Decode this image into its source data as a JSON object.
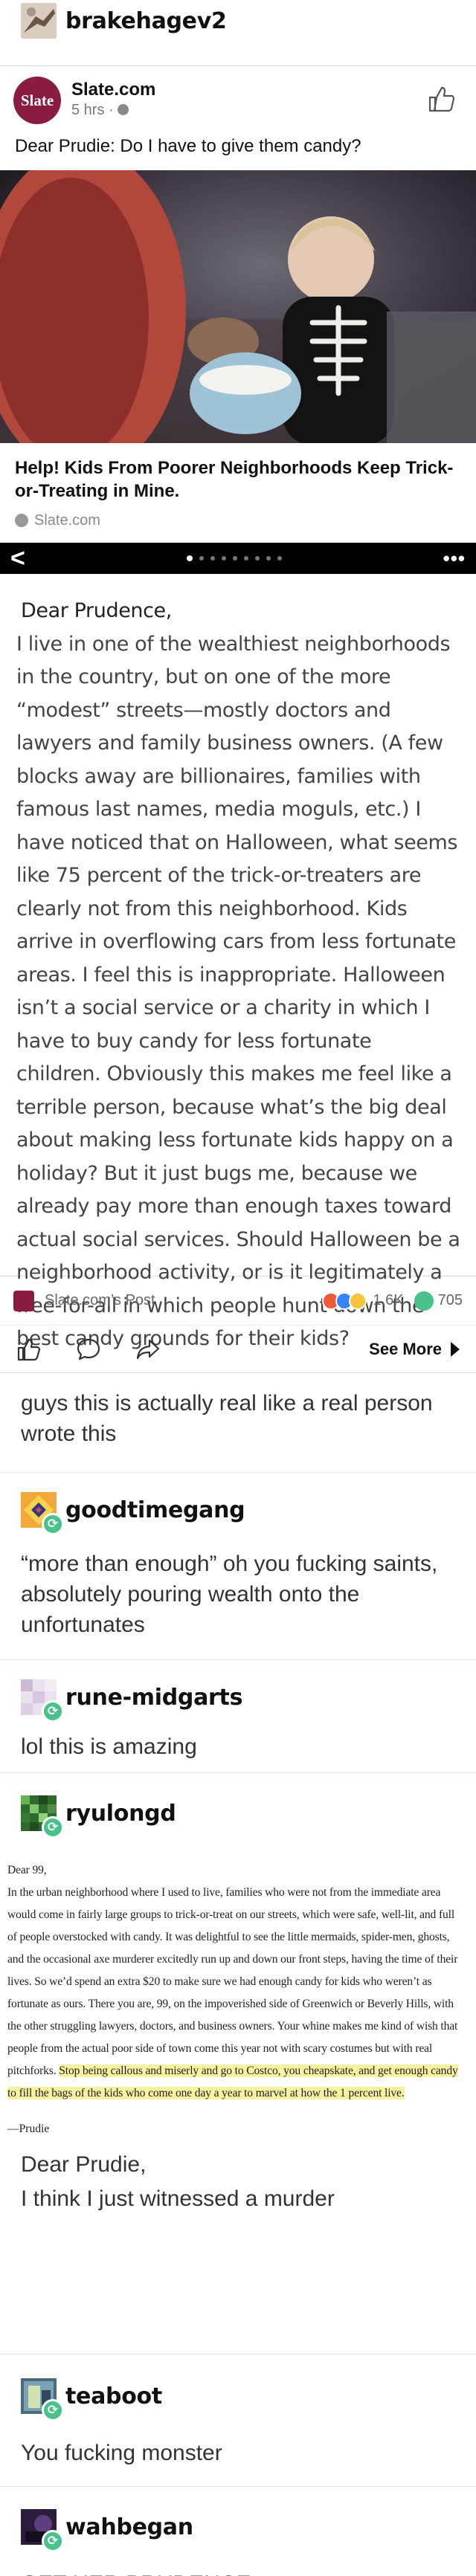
{
  "post": {
    "original_user": "brakehagev2",
    "fb_embed": {
      "source_name": "Slate.com",
      "logo_text": "Slate",
      "time": "5 hrs · ",
      "caption": "Dear Prudie: Do I have to give them candy?",
      "link_title": "Help! Kids From Poorer Neighborhoods Keep Trick-or-Treating in Mine.",
      "link_domain": "Slate.com",
      "carousel_back": "<",
      "carousel_more": "•••",
      "letter_greeting": "Dear Prudence,",
      "letter_body": "I live in one of the wealthiest neighborhoods in the country, but on one of the more “modest” streets—mostly doctors and lawyers and family business owners. (A few blocks away are billionaires, families with famous last names, media moguls, etc.) I have noticed that on Halloween, what seems like 75 percent of the trick-or-treaters are clearly not from this neighborhood. Kids arrive in overflowing cars from less fortunate areas. I feel this is inappropriate. Halloween isn’t a social service or a charity in which I have to buy candy for less fortunate children. Obviously this makes me feel like a terrible person, because what’s the big deal about making less fortunate kids happy on a holiday? But it just bugs me, because we already pay more than enough taxes toward actual social services. Should Halloween be a neighborhood activity, or is it legitimately a free-for-all in which people hunt down the best candy grounds for their kids?",
      "post_of": "Slate.com’s Post",
      "reaction_count": "1.6K",
      "comment_count": "705",
      "see_more": "See More"
    }
  },
  "replies": [
    {
      "user": "",
      "text": "guys this is actually real like a real person wrote this"
    },
    {
      "user": "goodtimegang",
      "text": "“more than enough” oh you fucking saints, absolutely pouring wealth onto the unfortunates"
    },
    {
      "user": "rune-midgarts",
      "text": "lol this is amazing"
    },
    {
      "user": "ryulongd",
      "text": "Dear Prudie,\nI think I just witnessed a murder"
    },
    {
      "user": "teaboot",
      "text": "You fucking monster"
    },
    {
      "user": "wahbegan",
      "text": "GET HER PRUDENCE"
    }
  ],
  "prudie_answer": {
    "salutation": "Dear 99,",
    "body_plain": "In the urban neighborhood where I used to live, families who were not from the immediate area would come in fairly large groups to trick-or-treat on our streets, which were safe, well-lit, and full of people overstocked with candy. It was delightful to see the little mermaids, spider-men, ghosts, and the occasional axe murderer excitedly run up and down our front steps, having the time of their lives. So we’d spend an extra $20 to make sure we had enough candy for kids who weren’t as fortunate as ours. There you are, 99, on the impoverished side of Greenwich or Beverly Hills, with the other struggling lawyers, doctors, and business owners. Your whine makes me kind of wish that people from the actual poor side of town come this year not with scary costumes but with real pitchforks. ",
    "body_highlight": "Stop being callous and miserly and go to Costco, you cheapskate, and get enough candy to fill the bags of the kids who come one day a year to marvel at how the 1 percent live.",
    "signature": "—Prudie"
  },
  "colors": {
    "slate_brand": "#8a1c44",
    "reblog_green": "#4ac08a",
    "highlight": "#f8f2a0"
  }
}
